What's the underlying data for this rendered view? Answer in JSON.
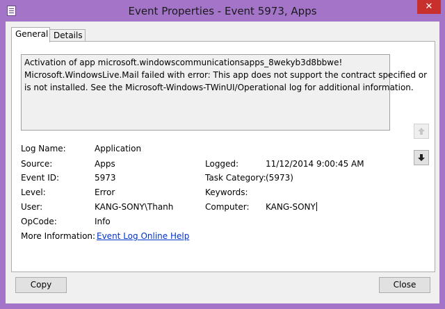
{
  "window": {
    "title": "Event Properties - Event 5973, Apps",
    "close_glyph": "✕"
  },
  "tabs": [
    {
      "label": "General"
    },
    {
      "label": "Details"
    }
  ],
  "message": {
    "lines": [
      "Activation of app microsoft.windowscommunicationsapps_8wekyb3d8bbwe!",
      "Microsoft.WindowsLive.Mail failed with error: This app does not support the contract specified or",
      "is not installed. See the Microsoft-Windows-TWinUI/Operational log for additional information."
    ]
  },
  "fields": {
    "log_name": {
      "label": "Log Name:",
      "value": "Application"
    },
    "source": {
      "label": "Source:",
      "value": "Apps"
    },
    "event_id": {
      "label": "Event ID:",
      "value": "5973"
    },
    "level": {
      "label": "Level:",
      "value": "Error"
    },
    "user": {
      "label": "User:",
      "value": "KANG-SONY\\Thanh"
    },
    "opcode": {
      "label": "OpCode:",
      "value": "Info"
    },
    "more_info": {
      "label": "More Information:",
      "value": "Event Log Online Help"
    },
    "logged": {
      "label": "Logged:",
      "value": "11/12/2014 9:00:45 AM"
    },
    "task_category": {
      "label": "Task Category:",
      "value": "(5973)"
    },
    "keywords": {
      "label": "Keywords:",
      "value": ""
    },
    "computer": {
      "label": "Computer:",
      "value": "KANG-SONY"
    }
  },
  "buttons": {
    "copy": "Copy",
    "close": "Close"
  },
  "icons": {
    "up": "arrow-up-icon",
    "down": "arrow-down-icon",
    "app": "event-log-icon"
  }
}
